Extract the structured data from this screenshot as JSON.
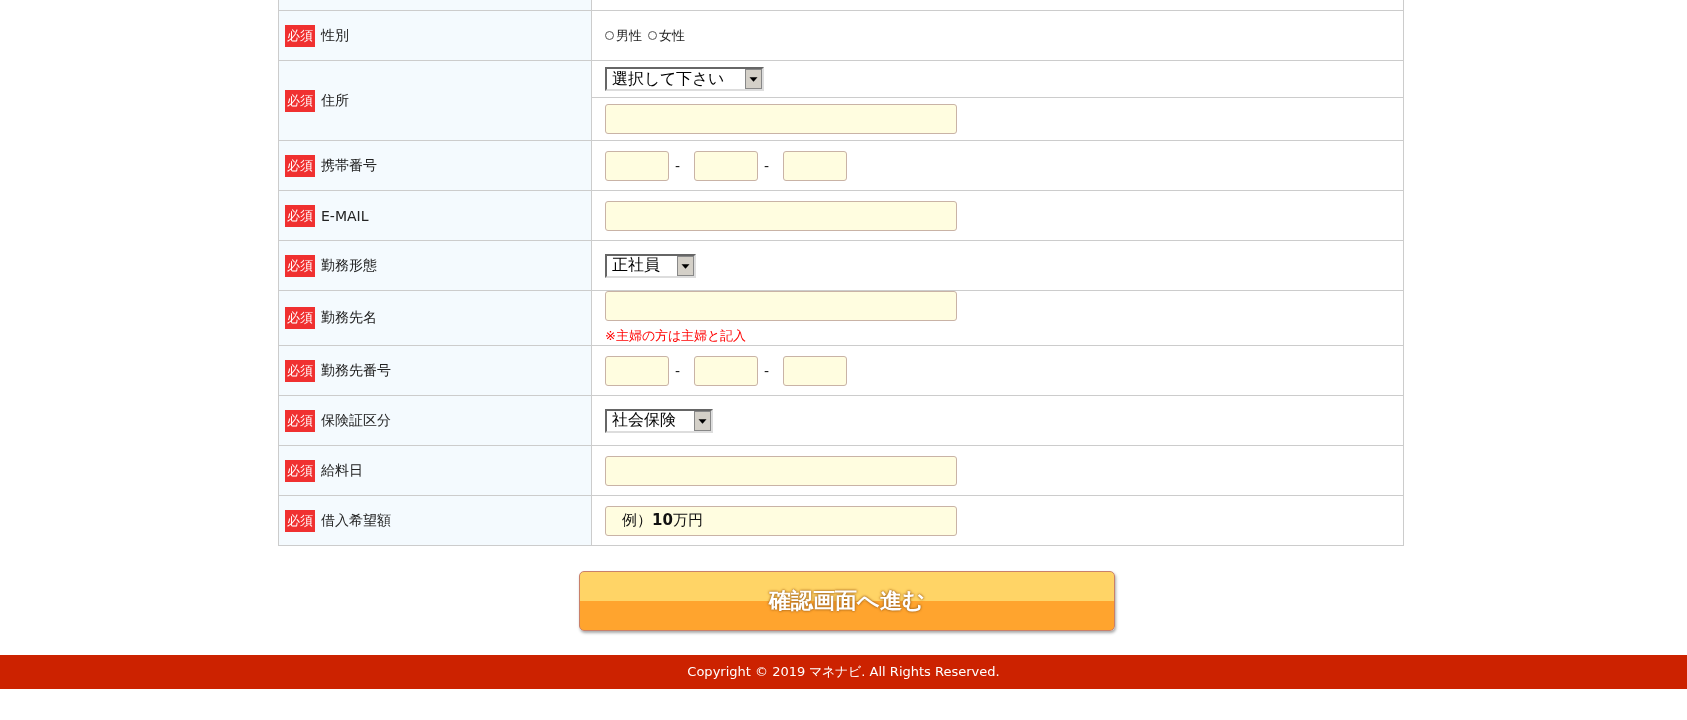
{
  "form": {
    "rows": [
      {
        "kind": "blank"
      },
      {
        "kind": "radio",
        "badge": "必須",
        "label": "性別",
        "options": [
          {
            "label": "男性",
            "selected": false
          },
          {
            "label": "女性",
            "selected": false
          }
        ]
      },
      {
        "kind": "address",
        "badge": "必須",
        "label": "住所",
        "select": "選択して下さい"
      },
      {
        "kind": "phone",
        "badge": "必須",
        "label": "携帯番号",
        "separators": [
          "-",
          "-"
        ]
      },
      {
        "kind": "text",
        "badge": "必須",
        "label": "E-MAIL"
      },
      {
        "kind": "select",
        "badge": "必須",
        "label": "勤務形態",
        "select": "正社員"
      },
      {
        "kind": "text",
        "badge": "必須",
        "label": "勤務先名",
        "note": "※主婦の方は主婦と記入"
      },
      {
        "kind": "phone",
        "badge": "必須",
        "label": "勤務先番号",
        "separators": [
          "-",
          "-"
        ]
      },
      {
        "kind": "select",
        "badge": "必須",
        "label": "保険証区分",
        "select": "社会保険"
      },
      {
        "kind": "text",
        "badge": "必須",
        "label": "給料日"
      },
      {
        "kind": "text",
        "badge": "必須",
        "label": "借入希望額",
        "value": "例）**10**万円"
      }
    ]
  },
  "submit_button": "確認画面へ進む",
  "footer": {
    "copyright": "Copyright © 2019 マネナビ. All Rights Reserved."
  }
}
